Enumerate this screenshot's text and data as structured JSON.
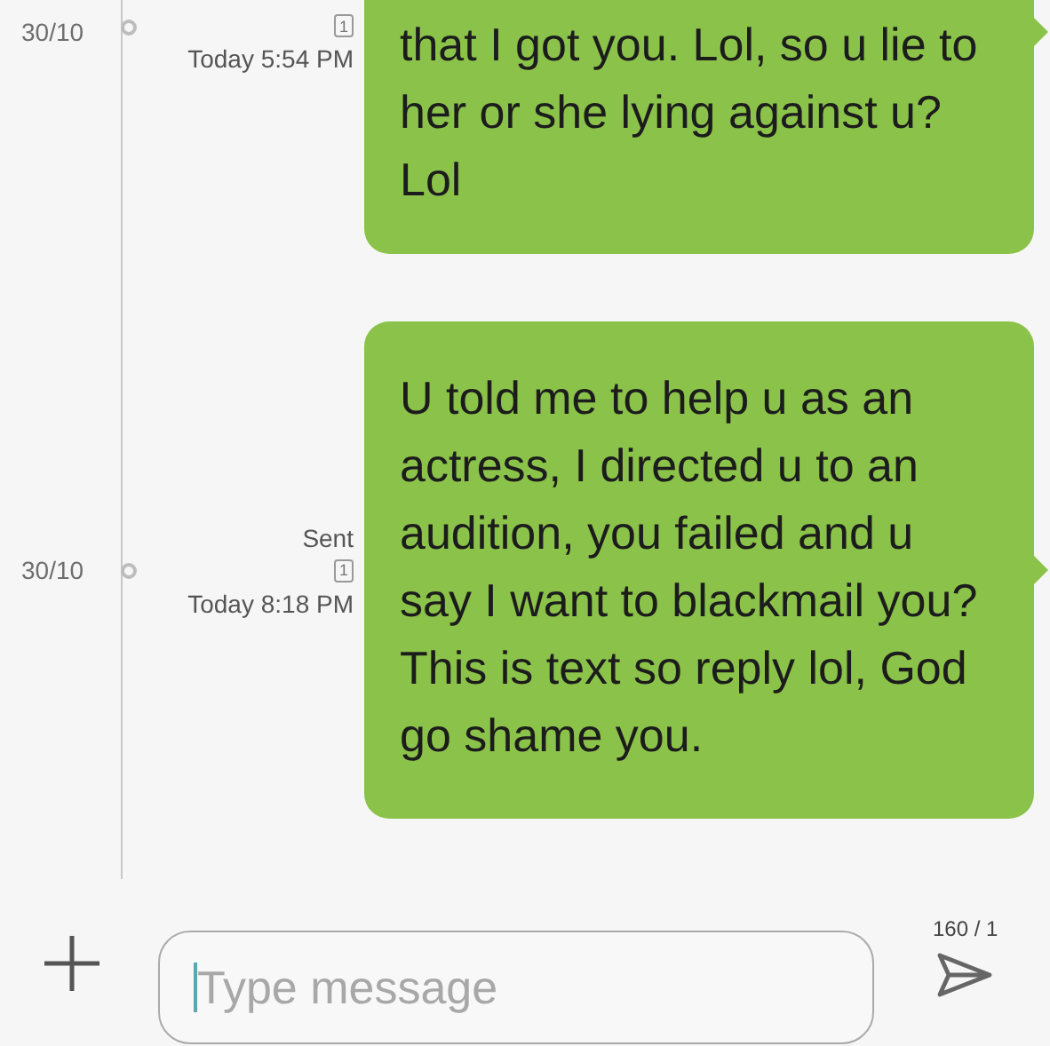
{
  "messages": [
    {
      "date": "30/10",
      "parts": "1",
      "timestamp": "Today 5:54 PM",
      "text": "that I got you. Lol, so u lie to her or she lying against u? Lol"
    },
    {
      "date": "30/10",
      "status": "Sent",
      "parts": "1",
      "timestamp": "Today 8:18 PM",
      "text": "U told me to help u as an actress, I directed u to an audition, you failed and u say I want to blackmail you? This is text so reply lol, God go shame you."
    }
  ],
  "composer": {
    "placeholder": "Type message",
    "counter": "160 / 1"
  }
}
